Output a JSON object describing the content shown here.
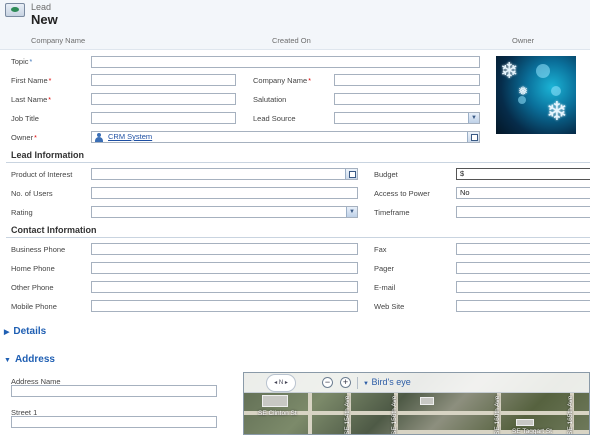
{
  "header": {
    "entity": "Lead",
    "title": "New",
    "columns": [
      "Company Name",
      "Created On",
      "Owner"
    ]
  },
  "general": {
    "topic": "Topic",
    "first_name": "First Name",
    "last_name": "Last Name",
    "job_title": "Job Title",
    "owner": "Owner",
    "owner_value": "CRM System",
    "company_name": "Company Name",
    "salutation": "Salutation",
    "lead_source": "Lead Source"
  },
  "lead_info": {
    "title": "Lead Information",
    "product_of_interest": "Product of Interest",
    "no_of_users": "No. of Users",
    "rating": "Rating",
    "budget": "Budget",
    "budget_value": "$",
    "access_to_power": "Access to Power",
    "access_to_power_value": "No",
    "timeframe": "Timeframe"
  },
  "contact_info": {
    "title": "Contact Information",
    "business_phone": "Business Phone",
    "home_phone": "Home Phone",
    "other_phone": "Other Phone",
    "mobile_phone": "Mobile Phone",
    "fax": "Fax",
    "pager": "Pager",
    "email": "E-mail",
    "web_site": "Web Site"
  },
  "details": {
    "title": "Details"
  },
  "address": {
    "title": "Address",
    "address_name": "Address Name",
    "street1": "Street 1"
  },
  "map": {
    "view_mode": "Bird's eye",
    "nav_label": "N",
    "zoom_out": "−",
    "zoom_in": "+",
    "streets": [
      "SE Clinton St",
      "SE 154th Ave",
      "SE 156th Ave",
      "SE 160th Ave",
      "SE 165th Ave",
      "SE Taggart St"
    ]
  },
  "colors": {
    "accent": "#1f5fb3",
    "required": "#dd0000",
    "link": "#1d4fa3"
  },
  "icons": {
    "entity": "lead-entity-icon",
    "owner": "user-icon",
    "lookup": "lookup-icon",
    "dropdown": "chevron-down-icon"
  }
}
